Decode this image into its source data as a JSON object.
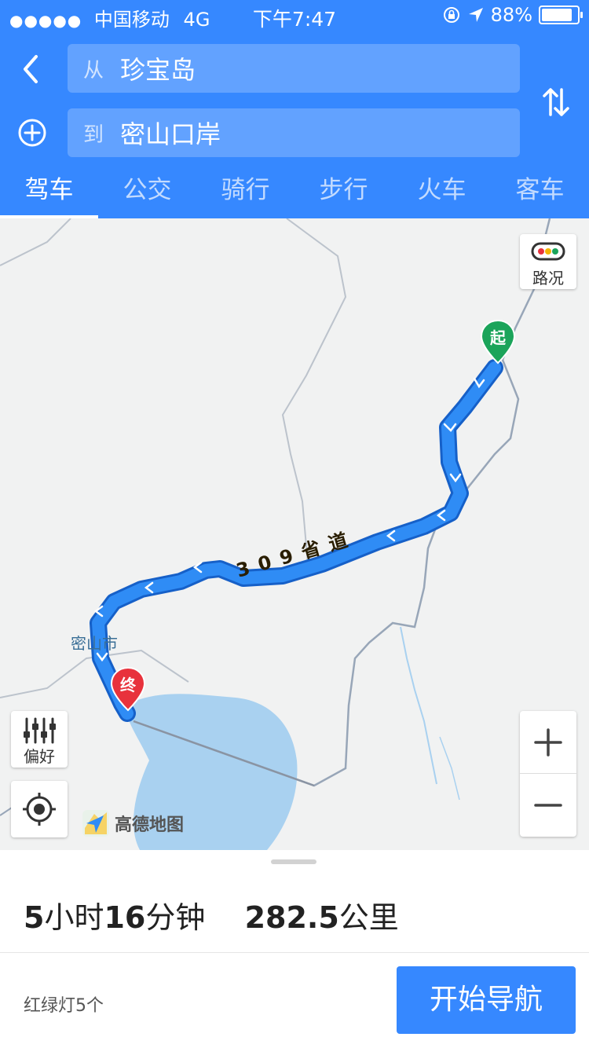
{
  "status_bar": {
    "carrier": "中国移动",
    "network": "4G",
    "time": "下午7:47",
    "battery_percent": "88%"
  },
  "route_inputs": {
    "from_prefix": "从",
    "from_value": "珍宝岛",
    "to_prefix": "到",
    "to_value": "密山口岸"
  },
  "tabs": [
    {
      "label": "驾车",
      "active": true
    },
    {
      "label": "公交",
      "active": false
    },
    {
      "label": "骑行",
      "active": false
    },
    {
      "label": "步行",
      "active": false
    },
    {
      "label": "火车",
      "active": false
    },
    {
      "label": "客车",
      "active": false
    }
  ],
  "map": {
    "traffic_label": "路况",
    "preference_label": "偏好",
    "start_marker": "起",
    "end_marker": "终",
    "town_label": "密山市",
    "road_label": "309省道",
    "logo_text": "高德地图",
    "zoom_in": "+",
    "zoom_out": "−"
  },
  "summary": {
    "hours": "5",
    "hours_unit": "小时",
    "minutes": "16",
    "minutes_unit": "分钟",
    "distance": "282.5",
    "distance_unit": "公里",
    "traffic_lights": "红绿灯5个",
    "start_button": "开始导航"
  },
  "colors": {
    "brand_blue": "#3688ff",
    "route_blue": "#2f8cf5",
    "route_outline": "#1660c8",
    "start_pin": "#1ba45a",
    "end_pin": "#e8323c",
    "water": "#a9d1f0"
  }
}
